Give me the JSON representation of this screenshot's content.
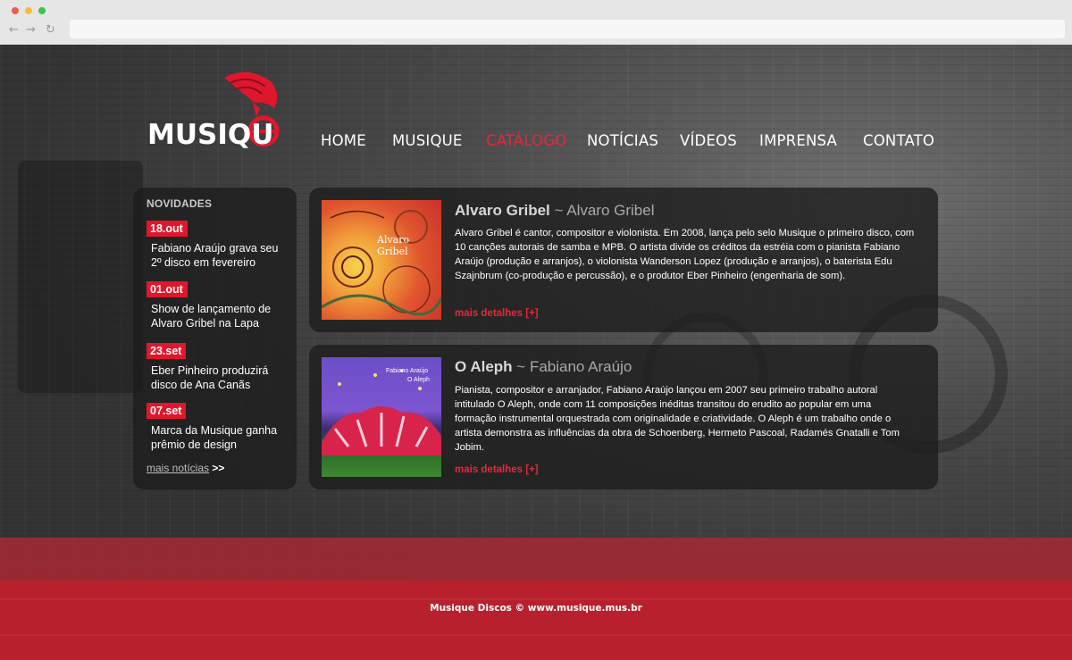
{
  "logo": {
    "text": "MUSIQUe"
  },
  "nav": {
    "items": [
      "HOME",
      "MUSIQUE",
      "CATÁLOGO",
      "NOTÍCIAS",
      "VÍDEOS",
      "IMPRENSA",
      "CONTATO"
    ],
    "active": "CATÁLOGO"
  },
  "sidebar": {
    "title": "NOVIDADES",
    "items": [
      {
        "date": "18.out",
        "text": "Fabiano Araújo grava seu 2º disco em fevereiro"
      },
      {
        "date": "01.out",
        "text": "Show de lançamento de Alvaro Gribel na Lapa"
      },
      {
        "date": "23.set",
        "text": "Eber Pinheiro produzirá disco de  Ana Canãs"
      },
      {
        "date": "07.set",
        "text": "Marca da Musique ganha prêmio de design"
      }
    ],
    "more_label": "mais notícias",
    "more_arrow": ">>"
  },
  "catalog": [
    {
      "title": "Alvaro Gribel",
      "separator": "~",
      "artist": "Alvaro Gribel",
      "cover_text": "Alvaro Gribel",
      "description": "Alvaro Gribel é cantor, compositor e violonista. Em 2008, lança pelo selo Musique o primeiro disco, com 10 canções autorais de samba e MPB. O artista divide os créditos da estréia com o pianista Fabiano Araújo (produção e arranjos), o violonista Wanderson Lopez (produção e arranjos), o baterista Edu Szajnbrum (co-produção e percussão), e o produtor Eber Pinheiro (engenharia de som).",
      "more": "mais detalhes [+]"
    },
    {
      "title": "O Aleph",
      "separator": "~",
      "artist": "Fabiano Araújo",
      "cover_text_1": "Fabiano Araújo",
      "cover_text_2": "O Aleph",
      "description": "Pianista, compositor e arranjador, Fabiano Araújo lançou em 2007 seu primeiro trabalho autoral intitulado O Aleph, onde com 11 composições inéditas transitou do erudito ao popular em uma formação instrumental orquestrada com originalidade e criatividade. O Aleph é um trabalho onde o artista demonstra as influências da obra de Schoenberg, Hermeto Pascoal, Radamés Gnatalli e Tom Jobim.",
      "more": "mais detalhes [+]"
    }
  ],
  "footer": {
    "text": "Musique Discos © www.musique.mus.br"
  },
  "colors": {
    "accent": "#e8263a",
    "badge": "#e0172c",
    "footer_band": "#b8202d"
  }
}
